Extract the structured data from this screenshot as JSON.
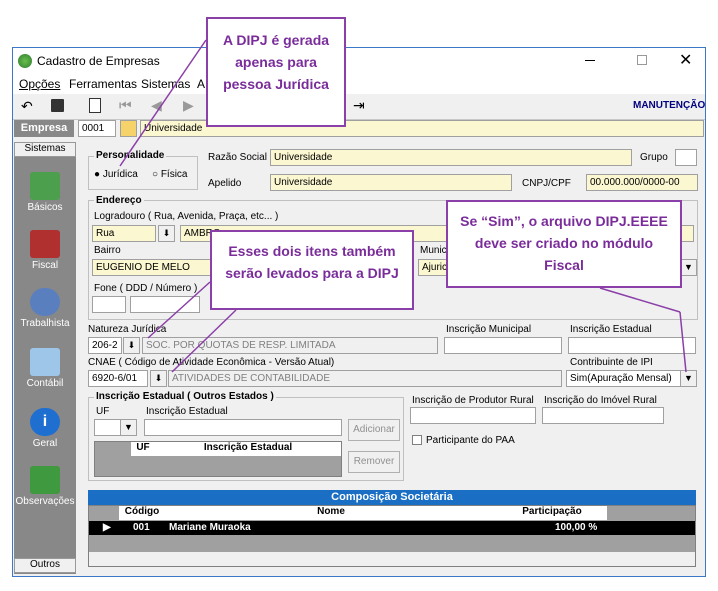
{
  "window": {
    "title": "Cadastro de Empresas",
    "mode": "MANUTENÇÃO"
  },
  "menu": [
    "Opções",
    "Ferramentas",
    "Sistemas",
    "A"
  ],
  "empresa": {
    "label": "Empresa",
    "code": "0001",
    "name": "Universidade"
  },
  "sidebar": {
    "header": "Sistemas",
    "items": [
      {
        "label": "Básicos"
      },
      {
        "label": "Fiscal"
      },
      {
        "label": "Trabalhista"
      },
      {
        "label": "Contábil"
      },
      {
        "label": "Geral"
      },
      {
        "label": "Observações"
      }
    ],
    "footer": "Outros"
  },
  "personalidade": {
    "title": "Personalidade",
    "opt1": "Jurídica",
    "opt2": "Física"
  },
  "razao_social": {
    "label": "Razão Social",
    "value": "Universidade"
  },
  "grupo": {
    "label": "Grupo"
  },
  "apelido": {
    "label": "Apelido",
    "value": "Universidade"
  },
  "cnpj": {
    "label": "CNPJ/CPF",
    "value": "00.000.000/0000-00"
  },
  "endereco": {
    "title": "Endereço",
    "logradouro_label": "Logradouro ( Rua, Avenida, Praça, etc... )",
    "tipo": "Rua",
    "logradouro": "AMBRO",
    "bairro_label": "Bairro",
    "bairro": "EUGENIO DE MELO",
    "municipio_label": "Munic",
    "municipio": "Ajuric",
    "fone_label": "Fone ( DDD / Número )"
  },
  "natureza": {
    "label": "Natureza Jurídica",
    "code": "206-2",
    "desc": "SOC. POR QUOTAS DE RESP. LIMITADA"
  },
  "insc_municipal": {
    "label": "Inscrição Municipal"
  },
  "insc_estadual": {
    "label": "Inscrição Estadual"
  },
  "cnae": {
    "label": "CNAE ( Código de Atividade Econômica - Versão Atual)",
    "code": "6920-6/01",
    "desc": "ATIVIDADES DE CONTABILIDADE"
  },
  "ipi": {
    "label": "Contribuinte de IPI",
    "value": "Sim(Apuração Mensal)"
  },
  "outros_estados": {
    "title": "Inscrição Estadual ( Outros Estados )",
    "uf_label": "UF",
    "ie_label": "Inscrição Estadual",
    "col_uf": "UF",
    "col_ie": "Inscrição Estadual",
    "add": "Adicionar",
    "remove": "Remover"
  },
  "produtor_rural": {
    "label": "Inscrição de Produtor Rural"
  },
  "imovel_rural": {
    "label": "Inscrição do Imóvel Rural"
  },
  "paa": {
    "label": "Participante do PAA"
  },
  "composicao": {
    "title": "Composição Societária",
    "cols": [
      "Código",
      "Nome",
      "Participação"
    ],
    "rows": [
      {
        "codigo": "001",
        "nome": "Mariane Muraoka",
        "participacao": "100,00 %"
      }
    ]
  },
  "callouts": {
    "c1": "A DIPJ é gerada apenas para pessoa Jurídica",
    "c2": "Esses dois itens também serão levados para a DIPJ",
    "c3": "Se “Sim”, o arquivo DIPJ.EEEE deve ser criado no módulo Fiscal"
  },
  "colors": {
    "callout": "#8b3fa8",
    "grid_header": "#1a6fc4",
    "yellow_field": "#fbf7d0"
  }
}
